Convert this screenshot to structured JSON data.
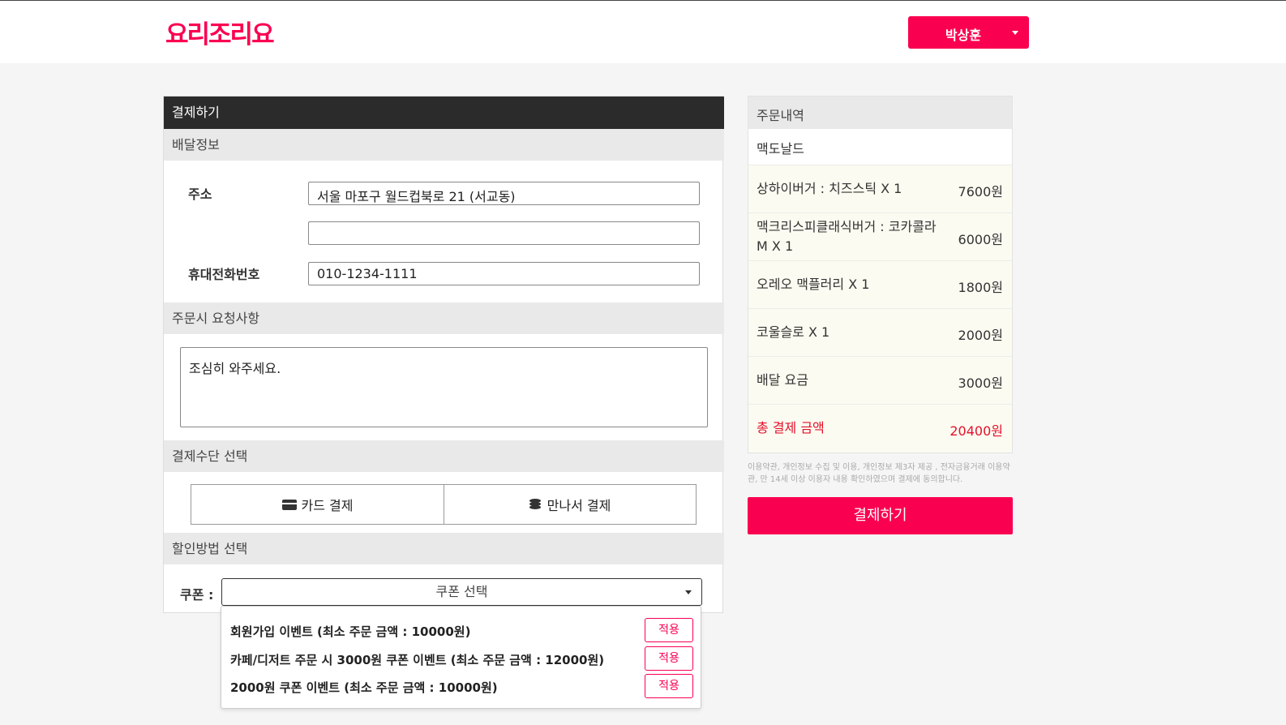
{
  "header": {
    "logo": "요리조리요",
    "user_name": "박상훈"
  },
  "checkout": {
    "title": "결제하기",
    "delivery": {
      "section_title": "배달정보",
      "address_label": "주소",
      "address_value": "서울 마포구 월드컵북로 21 (서교동)",
      "address_detail_value": "",
      "phone_label": "휴대전화번호",
      "phone_value": "010-1234-1111"
    },
    "request": {
      "section_title": "주문시 요청사항",
      "value": "조심히 와주세요."
    },
    "payment": {
      "section_title": "결제수단 선택",
      "card_label": "카드 결제",
      "cash_label": "만나서 결제"
    },
    "discount": {
      "section_title": "할인방법 선택",
      "coupon_label": "쿠폰 :",
      "coupon_placeholder": "쿠폰 선택",
      "coupons": [
        {
          "text": "회원가입 이벤트 (최소 주문 금액 : 10000원)",
          "apply": "적용"
        },
        {
          "text": "카페/디저트 주문 시 3000원 쿠폰 이벤트 (최소 주문 금액 : 12000원)",
          "apply": "적용"
        },
        {
          "text": "2000원 쿠폰 이벤트 (최소 주문 금액 : 10000원)",
          "apply": "적용"
        }
      ]
    }
  },
  "order": {
    "title": "주문내역",
    "store": "맥도날드",
    "items": [
      {
        "name": "상하이버거 : 치즈스틱 X 1",
        "price": "7600원"
      },
      {
        "name": "맥크리스피클래식버거 : 코카콜라 M X 1",
        "price": "6000원"
      },
      {
        "name": "오레오 맥플러리 X 1",
        "price": "1800원"
      },
      {
        "name": "코울슬로 X 1",
        "price": "2000원"
      },
      {
        "name": "배달 요금",
        "price": "3000원"
      }
    ],
    "total_label": "총 결제 금액",
    "total_value": "20400원",
    "terms": "이용약관, 개인정보 수집 및 이용, 개인정보 제3자 제공 , 전자금융거래 이용약관, 만 14세 이상 이용자 내용 확인하였으며 결제에 동의합니다.",
    "checkout_button": "결제하기"
  },
  "colors": {
    "brand": "#fa0050",
    "total_red": "#e5112a",
    "dark_header": "#2b2b2b"
  }
}
